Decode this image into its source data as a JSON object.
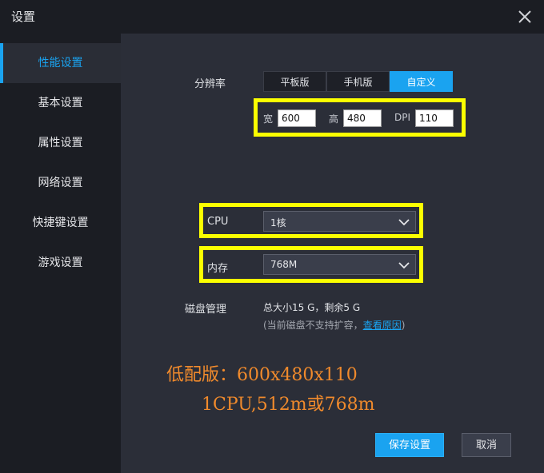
{
  "window": {
    "title": "设置"
  },
  "sidebar": {
    "items": [
      {
        "label": "性能设置",
        "active": true
      },
      {
        "label": "基本设置"
      },
      {
        "label": "属性设置"
      },
      {
        "label": "网络设置"
      },
      {
        "label": "快捷键设置"
      },
      {
        "label": "游戏设置"
      }
    ]
  },
  "resolution": {
    "label": "分辨率",
    "options": [
      "平板版",
      "手机版",
      "自定义"
    ],
    "selected": "自定义",
    "width_label": "宽",
    "width_value": "600",
    "height_label": "高",
    "height_value": "480",
    "dpi_label": "DPI",
    "dpi_value": "110"
  },
  "cpu": {
    "label": "CPU",
    "value": "1核"
  },
  "memory": {
    "label": "内存",
    "value": "768M"
  },
  "disk": {
    "label": "磁盘管理",
    "summary": "总大小15 G，剩余5 G",
    "note_prefix": "(当前磁盘不支持扩容，",
    "note_link": "查看原因",
    "note_suffix": ")"
  },
  "annotation": {
    "line1": "低配版：600x480x110",
    "line2": "1CPU,512m或768m"
  },
  "buttons": {
    "save": "保存设置",
    "cancel": "取消"
  },
  "colors": {
    "accent": "#1aa3f0",
    "highlight": "#fbff00",
    "annotation": "#f08a2c",
    "panel": "#2b2e38",
    "sidebar": "#1b1d23"
  }
}
